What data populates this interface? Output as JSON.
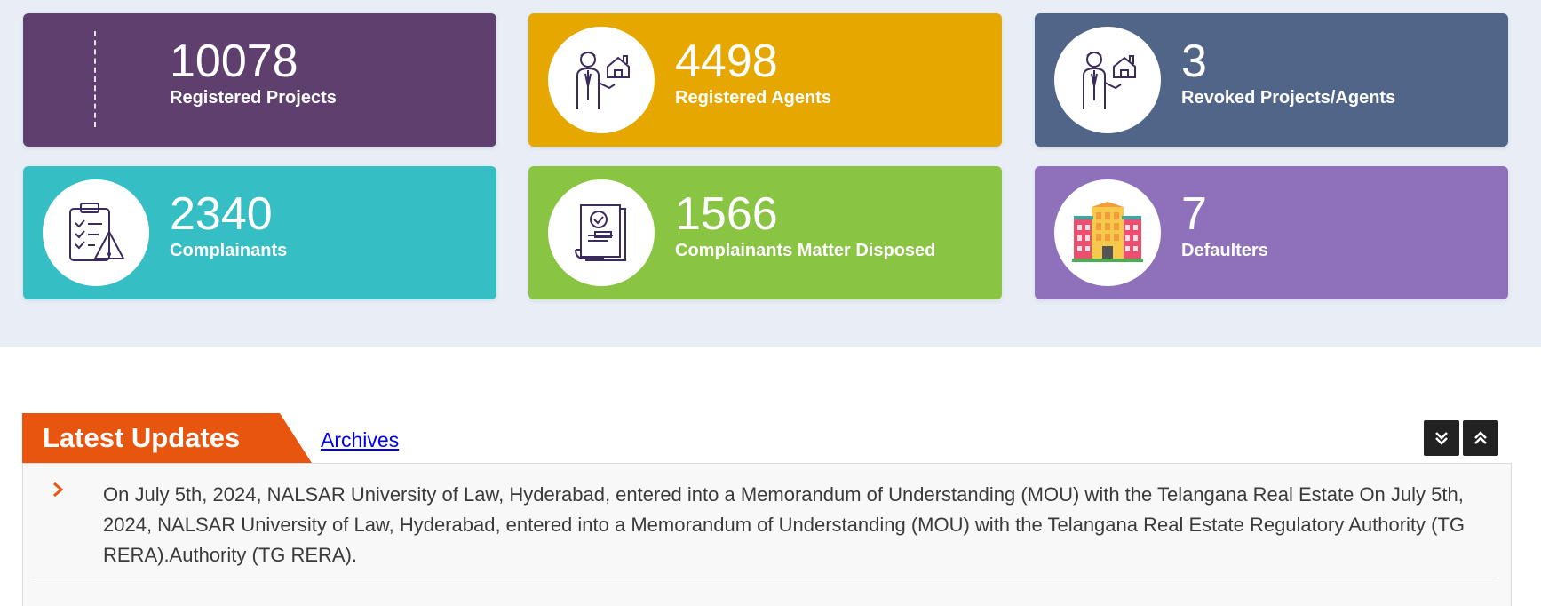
{
  "stats": [
    {
      "value": "10078",
      "label": "Registered Projects",
      "color": "#5e3f6e",
      "icon": "dashed-line-icon"
    },
    {
      "value": "4498",
      "label": "Registered Agents",
      "color": "#e6a800",
      "icon": "agent-house-icon"
    },
    {
      "value": "3",
      "label": "Revoked Projects/Agents",
      "color": "#506587",
      "icon": "agent-house-icon"
    },
    {
      "value": "2340",
      "label": "Complainants",
      "color": "#35bec3",
      "icon": "clipboard-warning-icon"
    },
    {
      "value": "1566",
      "label": "Complainants Matter Disposed",
      "color": "#8ac443",
      "icon": "document-check-icon"
    },
    {
      "value": "7",
      "label": "Defaulters",
      "color": "#8e71ba",
      "icon": "building-icon"
    }
  ],
  "updates": {
    "title": "Latest Updates",
    "archives_label": "Archives",
    "accent": "#e8550f",
    "items": [
      "On July 5th, 2024, NALSAR University of Law, Hyderabad, entered into a Memorandum of Understanding (MOU) with the Telangana Real Estate On July 5th, 2024, NALSAR University of Law, Hyderabad, entered into a Memorandum of Understanding (MOU) with the Telangana Real Estate Regulatory Authority (TG RERA).Authority (TG RERA)."
    ]
  }
}
